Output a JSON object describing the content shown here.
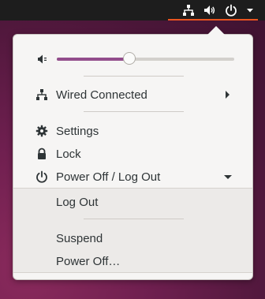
{
  "topbar": {
    "tray_icons": [
      "network-wired-icon",
      "volume-icon",
      "power-icon",
      "dropdown-arrow-icon"
    ],
    "accent_color": "#e95420"
  },
  "menu": {
    "volume": {
      "icon": "volume-muted-icon",
      "level": 0.41
    },
    "network": {
      "label": "Wired Connected",
      "icon": "network-wired-icon"
    },
    "settings": {
      "label": "Settings",
      "icon": "gear-icon"
    },
    "lock": {
      "label": "Lock",
      "icon": "lock-icon"
    },
    "power": {
      "label": "Power Off / Log Out",
      "icon": "power-icon",
      "submenu": {
        "log_out": "Log Out",
        "suspend": "Suspend",
        "power_off": "Power Off…"
      }
    },
    "slider_color": "#924d8b"
  }
}
